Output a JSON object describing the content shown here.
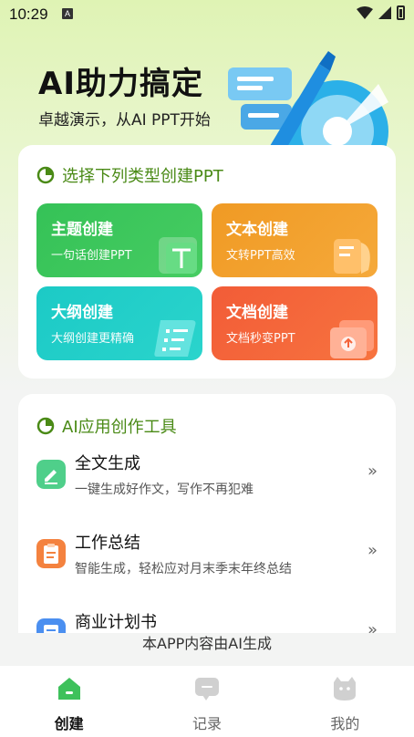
{
  "status_bar": {
    "time": "10:29",
    "notif_letter": "A"
  },
  "hero": {
    "title": "AI助力搞定",
    "subtitle": "卓越演示，从AI PPT开始"
  },
  "create_section": {
    "title": "选择下列类型创建PPT",
    "tiles": [
      {
        "title": "主题创建",
        "subtitle": "一句话创建PPT",
        "color": "#3cc45c"
      },
      {
        "title": "文本创建",
        "subtitle": "文转PPT高效",
        "color": "#f29d29"
      },
      {
        "title": "大纲创建",
        "subtitle": "大纲创建更精确",
        "color": "#20cdc8"
      },
      {
        "title": "文档创建",
        "subtitle": "文档秒变PPT",
        "color": "#f4643a"
      }
    ]
  },
  "tools_section": {
    "title": "AI应用创作工具",
    "items": [
      {
        "name": "全文生成",
        "desc": "一键生成好作文，写作不再犯难",
        "icon": "pen-doc-icon",
        "color": "#4fcf8a"
      },
      {
        "name": "工作总结",
        "desc": "智能生成，轻松应对月末季末年终总结",
        "icon": "clipboard-icon",
        "color": "#f4823f"
      },
      {
        "name": "商业计划书",
        "desc": "",
        "icon": "document-icon",
        "color": "#4b8ff0"
      }
    ],
    "chevron": "»"
  },
  "ai_notice": "本APP内容由AI生成",
  "bottom_nav": {
    "items": [
      {
        "label": "创建",
        "icon": "home-icon",
        "active": true
      },
      {
        "label": "记录",
        "icon": "chat-icon",
        "active": false
      },
      {
        "label": "我的",
        "icon": "profile-icon",
        "active": false
      }
    ]
  },
  "colors": {
    "accent_green": "#4a8a16",
    "active_nav": "#3ec15b"
  }
}
